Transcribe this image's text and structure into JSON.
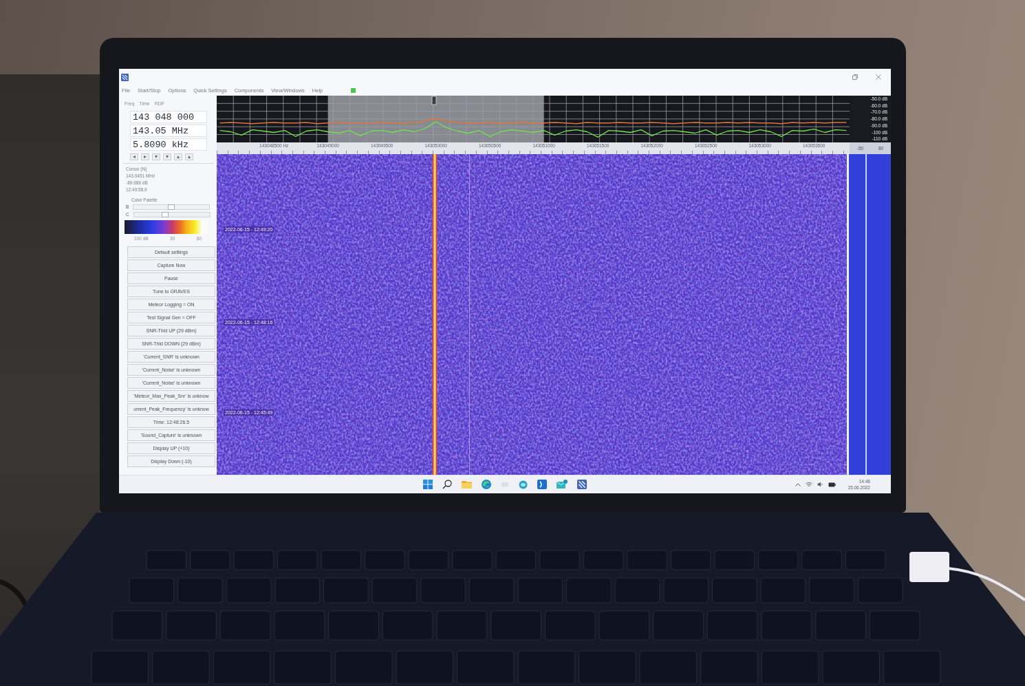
{
  "window": {
    "menu": [
      "File",
      "Start/Stop",
      "Options",
      "Quick Settings",
      "Components",
      "View/Windows",
      "Help"
    ]
  },
  "left_panel": {
    "view_menu": [
      "Freq",
      "Time",
      "RDF"
    ],
    "frequency_fields": [
      "143 048 000",
      "143.05 MHz",
      "5.8090 kHz"
    ],
    "cursor": {
      "title": "Cursor (N)",
      "lines": [
        "143.0451 MHz",
        "-89.686 dB",
        "12:49:58.9"
      ]
    },
    "palette": {
      "title": "Color Palette",
      "sliders": [
        {
          "label": "B",
          "level": 0.5
        },
        {
          "label": "C",
          "level": 0.4
        }
      ],
      "scale_labels": [
        "100 dB",
        "30",
        "60"
      ]
    },
    "buttons": [
      "Default settings",
      "Capture Now",
      "Pause",
      "Tune to GRAVES",
      "Meteor Logging = ON",
      "Test Signal Gen = OFF",
      "SNR-Thld UP (29 dBm)",
      "SNR-Thld DOWN (29 dBm)",
      "'Current_SNR' is unknown",
      "'Current_Noise' is unknown",
      "'Current_Noise' is unknown",
      "'Meteor_Max_Peak_Snr' is unknow",
      "urrent_Peak_Frequency' is unknow",
      "Time: 12:48:26.5",
      "'Sound_Capture' is unknown",
      "Display UP (+10)",
      "Display Down (-10)"
    ]
  },
  "spectrum": {
    "chart_data": {
      "type": "line",
      "grid": true,
      "x": [
        143048000,
        143048100,
        143048200,
        143048300,
        143048400,
        143048500,
        143048600,
        143048700,
        143048800,
        143048900,
        143049000,
        143049100,
        143049200,
        143049300,
        143049400,
        143049500,
        143049600,
        143049700,
        143049800,
        143049900,
        143050000,
        143050100,
        143050200,
        143050300,
        143050400,
        143050500,
        143050600,
        143050700,
        143050800,
        143050900,
        143051000,
        143051100,
        143051200,
        143051300,
        143051400,
        143051500,
        143051600,
        143051700,
        143051800,
        143051900,
        143052000,
        143052100,
        143052200,
        143052300,
        143052400,
        143052500,
        143052600,
        143052700,
        143052800,
        143052900,
        143053000,
        143053100,
        143053200,
        143053300,
        143053400,
        143053500,
        143053600,
        143053700,
        143053800
      ],
      "series": [
        {
          "color": "#72e24c",
          "values": [
            -97,
            -99,
            -104,
            -96,
            -98,
            -100,
            -97,
            -106,
            -98,
            -96,
            -99,
            -101,
            -97,
            -105,
            -98,
            -97,
            -100,
            -96,
            -99,
            -94,
            -84,
            -93,
            -98,
            -101,
            -97,
            -106,
            -99,
            -96,
            -98,
            -100,
            -97,
            -104,
            -98,
            -96,
            -99,
            -107,
            -97,
            -98,
            -100,
            -96,
            -105,
            -98,
            -97,
            -99,
            -101,
            -96,
            -104,
            -98,
            -97,
            -100,
            -96,
            -99,
            -106,
            -97,
            -98,
            -95,
            -100,
            -96,
            -97
          ]
        },
        {
          "color": "#e4733a",
          "values": [
            -86,
            -85,
            -86,
            -87,
            -86,
            -85,
            -86,
            -86,
            -85,
            -87,
            -86,
            -85,
            -86,
            -86,
            -87,
            -85,
            -86,
            -86,
            -85,
            -83,
            -79,
            -83,
            -85,
            -86,
            -86,
            -85,
            -87,
            -86,
            -85,
            -86,
            -86,
            -85,
            -86,
            -87,
            -85,
            -86,
            -86,
            -85,
            -86,
            -86,
            -85,
            -86,
            -87,
            -86,
            -85,
            -86,
            -86,
            -85,
            -86,
            -85,
            -86,
            -86,
            -87,
            -85,
            -86,
            -85,
            -86,
            -85,
            -85
          ]
        }
      ],
      "xlim": [
        143047970,
        143053830
      ],
      "ylim": [
        -114.9,
        -45.1
      ],
      "bands": [
        {
          "axis": "x",
          "from": 143049000,
          "to": 143051000
        }
      ],
      "xticks": [
        {
          "value": 143048500,
          "label": "143048500 Hz"
        },
        {
          "value": 143049000,
          "label": "143049000"
        },
        {
          "value": 143049500,
          "label": "143049500"
        },
        {
          "value": 143050000,
          "label": "143050000"
        },
        {
          "value": 143050500,
          "label": "143050500"
        },
        {
          "value": 143051000,
          "label": "143051000"
        },
        {
          "value": 143051500,
          "label": "143051500"
        },
        {
          "value": 143052000,
          "label": "143052000"
        },
        {
          "value": 143052500,
          "label": "143052500"
        },
        {
          "value": 143053000,
          "label": "143053000"
        },
        {
          "value": 143053500,
          "label": "143053500"
        }
      ],
      "yticks": [
        {
          "value": -50,
          "label": "-50.0 dB"
        },
        {
          "value": -60,
          "label": "-60.0 dB"
        },
        {
          "value": -70,
          "label": "-70.0 dB"
        },
        {
          "value": -80,
          "label": "-80.0 dB"
        },
        {
          "value": -90,
          "label": "-90.0 dB"
        },
        {
          "value": -100,
          "label": "-100 dB"
        },
        {
          "value": -110,
          "label": "-110 dB"
        }
      ]
    },
    "range_labels": [
      "-50",
      "80"
    ]
  },
  "waterfall": {
    "timestamps": [
      "2022-06-15 - 12:49:20",
      "2022-06-15 - 12:48:16",
      "2022-06-15 - 12:45:49"
    ]
  },
  "taskbar": {
    "clock": "14:48",
    "date": "15.06.2022"
  }
}
